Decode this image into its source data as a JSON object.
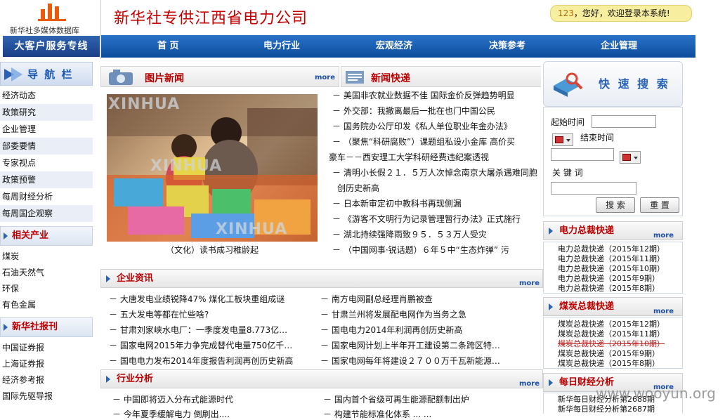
{
  "header": {
    "logo_sub": "新华社多媒体数据库",
    "logo_service": "大客户服务专线",
    "site_title": "新华社专供江西省电力公司",
    "welcome_num": "123",
    "welcome_text": "，您好，欢迎登录本系统!"
  },
  "nav": [
    "首 页",
    "电力行业",
    "宏观经济",
    "决策参考",
    "企业管理"
  ],
  "sidebar": {
    "nav_title": "导 航 栏",
    "nav_items": [
      "经济动态",
      "政策研究",
      "企业管理",
      "部委要情",
      "专家视点",
      "政策预警",
      "每周财经分析",
      "每周国企观察"
    ],
    "industry_title": "相关产业",
    "industry_items": [
      "煤炭",
      "石油天然气",
      "环保",
      "有色金属"
    ],
    "papers_title": "新华社报刊",
    "papers_items": [
      "中国证券报",
      "上海证券报",
      "经济参考报",
      "国际先驱导报"
    ]
  },
  "photo_news": {
    "title": "图片新闻",
    "more": "more",
    "caption": "（文化）读书成习稚龄起",
    "watermark": "XINHUA"
  },
  "news_flash": {
    "title": "新闻快递",
    "items": [
      "－ 美国非农就业数据不佳  国际金价反弹趋势明显",
      "－ 外交部：我撤离最后一批在也门中国公民",
      "－ 国务院办公厅印发《私人单位职业年金办法》",
      "－ （聚焦“科研腐败”）课题组私设小金库  高价买",
      "豪车－－西安理工大学科研经费违纪案透视",
      "－ 清明小长假２１．５万人次悼念南京大屠杀遇难同胞",
      "创历史新高",
      "－ 日本新审定初中教科书再现侧漏",
      "－ 《游客不文明行为记录管理暂行办法》正式施行",
      "－ 湖北持续强降雨致９５．５３万人受灾",
      "－ （中国网事·锐话题）６年５中“生态炸弹”  污"
    ]
  },
  "enterprise": {
    "title": "企业资讯",
    "more": "more",
    "left": [
      "－ 大唐发电业绩锐降47% 煤化工板块重组成谜",
      "－ 五大发电等都在忙些啥?",
      "－ 甘肃刘家峡水电厂：一季度发电量8.773亿…",
      "－ 国家电网2015年力争完成替代电量750亿千…",
      "－ 国电电力发布2014年度报告利润再创历史新高"
    ],
    "right": [
      "－ 南方电网副总经理肖鹏被查",
      "－ 甘肃兰州将发展配电网作为当务之急",
      "－ 国电电力2014年利润再创历史新高",
      "－ 国家电网计划上半年开工建设第二条跨区特…",
      "－ 国家电网每年将建设２７００万千瓦新能源…"
    ]
  },
  "industry_analysis": {
    "title": "行业分析",
    "more": "more",
    "left": [
      "－ 中国即将迈入分布式能源时代",
      "－ 今年夏季缓解电力  倒刷出...."
    ],
    "right": [
      "－ 国内首个省级可再生能源配额制出炉",
      "－ 构建节能标准化体系  ...  ..."
    ]
  },
  "search": {
    "title": "快 速 搜 索",
    "start_label": "起始时间",
    "end_label": "结束时间",
    "keyword_label": "关  键  词",
    "search_btn": "搜 索",
    "reset_btn": "重 置"
  },
  "power_brief": {
    "title": "电力总裁快递",
    "more": "more",
    "items": [
      "电力总裁快递（2015年12期）",
      "电力总裁快递（2015年11期）",
      "电力总裁快递（2015年10期）",
      "电力总裁快递（2015年9期）",
      "电力总裁快递（2015年8期）"
    ]
  },
  "coal_brief": {
    "title": "煤炭总裁快递",
    "more": "more",
    "items": [
      "煤炭总裁快递（2015年12期）",
      "煤炭总裁快递（2015年11期）",
      "煤炭总裁快递（2015年10期）",
      "煤炭总裁快递（2015年9期）",
      "煤炭总裁快递（2015年8期）"
    ]
  },
  "daily_finance": {
    "title": "每日财经分析",
    "more": "more",
    "items": [
      "新华每日财经分析第2688期",
      "新华每日财经分析第2687期"
    ]
  },
  "watermark": "www.wooyun.org",
  "colors": {
    "accent_red": "#c40000",
    "nav_blue": "#1a5db0",
    "link_blue": "#1c4ea6"
  }
}
